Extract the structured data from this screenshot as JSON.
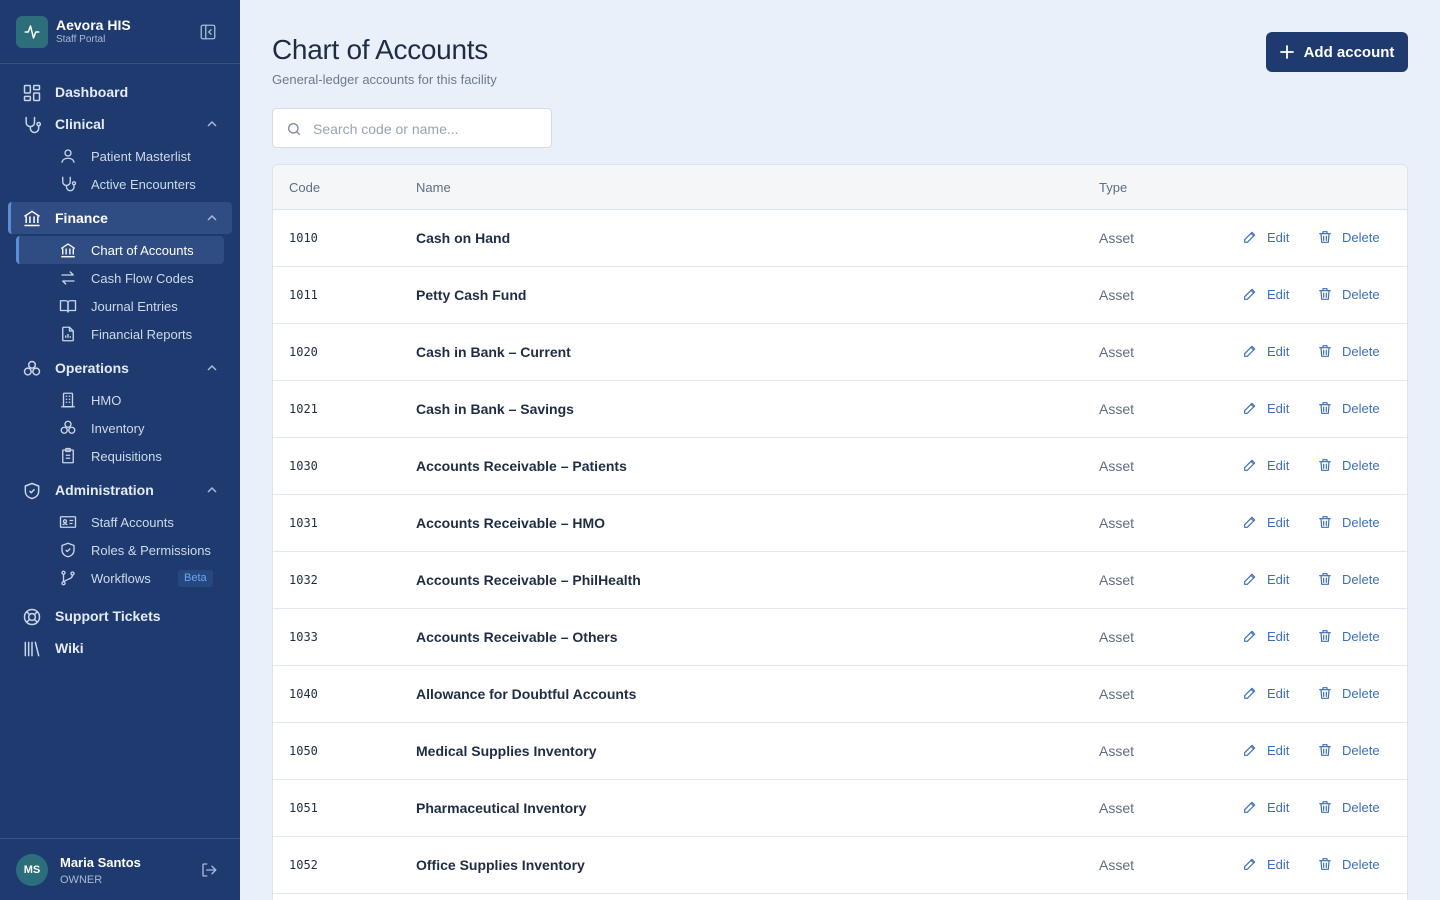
{
  "brand": {
    "name": "Aevora HIS",
    "subtitle": "Staff Portal"
  },
  "nav": {
    "dashboard": "Dashboard",
    "clinical": "Clinical",
    "patient_masterlist": "Patient Masterlist",
    "active_encounters": "Active Encounters",
    "finance": "Finance",
    "chart_of_accounts": "Chart of Accounts",
    "cash_flow_codes": "Cash Flow Codes",
    "journal_entries": "Journal Entries",
    "financial_reports": "Financial Reports",
    "operations": "Operations",
    "hmo": "HMO",
    "inventory": "Inventory",
    "requisitions": "Requisitions",
    "administration": "Administration",
    "staff_accounts": "Staff Accounts",
    "roles_permissions": "Roles & Permissions",
    "workflows": "Workflows",
    "workflows_badge": "Beta",
    "support_tickets": "Support Tickets",
    "wiki": "Wiki"
  },
  "user": {
    "initials": "MS",
    "name": "Maria Santos",
    "role": "OWNER"
  },
  "page": {
    "title": "Chart of Accounts",
    "subtitle": "General-ledger accounts for this facility",
    "add_button": "Add account",
    "search_placeholder": "Search code or name..."
  },
  "table": {
    "headers": {
      "code": "Code",
      "name": "Name",
      "type": "Type"
    },
    "edit_label": "Edit",
    "delete_label": "Delete",
    "rows": [
      {
        "code": "1010",
        "name": "Cash on Hand",
        "type": "Asset"
      },
      {
        "code": "1011",
        "name": "Petty Cash Fund",
        "type": "Asset"
      },
      {
        "code": "1020",
        "name": "Cash in Bank – Current",
        "type": "Asset"
      },
      {
        "code": "1021",
        "name": "Cash in Bank – Savings",
        "type": "Asset"
      },
      {
        "code": "1030",
        "name": "Accounts Receivable – Patients",
        "type": "Asset"
      },
      {
        "code": "1031",
        "name": "Accounts Receivable – HMO",
        "type": "Asset"
      },
      {
        "code": "1032",
        "name": "Accounts Receivable – PhilHealth",
        "type": "Asset"
      },
      {
        "code": "1033",
        "name": "Accounts Receivable – Others",
        "type": "Asset"
      },
      {
        "code": "1040",
        "name": "Allowance for Doubtful Accounts",
        "type": "Asset"
      },
      {
        "code": "1050",
        "name": "Medical Supplies Inventory",
        "type": "Asset"
      },
      {
        "code": "1051",
        "name": "Pharmaceutical Inventory",
        "type": "Asset"
      },
      {
        "code": "1052",
        "name": "Office Supplies Inventory",
        "type": "Asset"
      }
    ]
  },
  "colors": {
    "sidebar": "#1e3a6e",
    "accent": "#3d70b8",
    "background": "#eaf0f9"
  }
}
